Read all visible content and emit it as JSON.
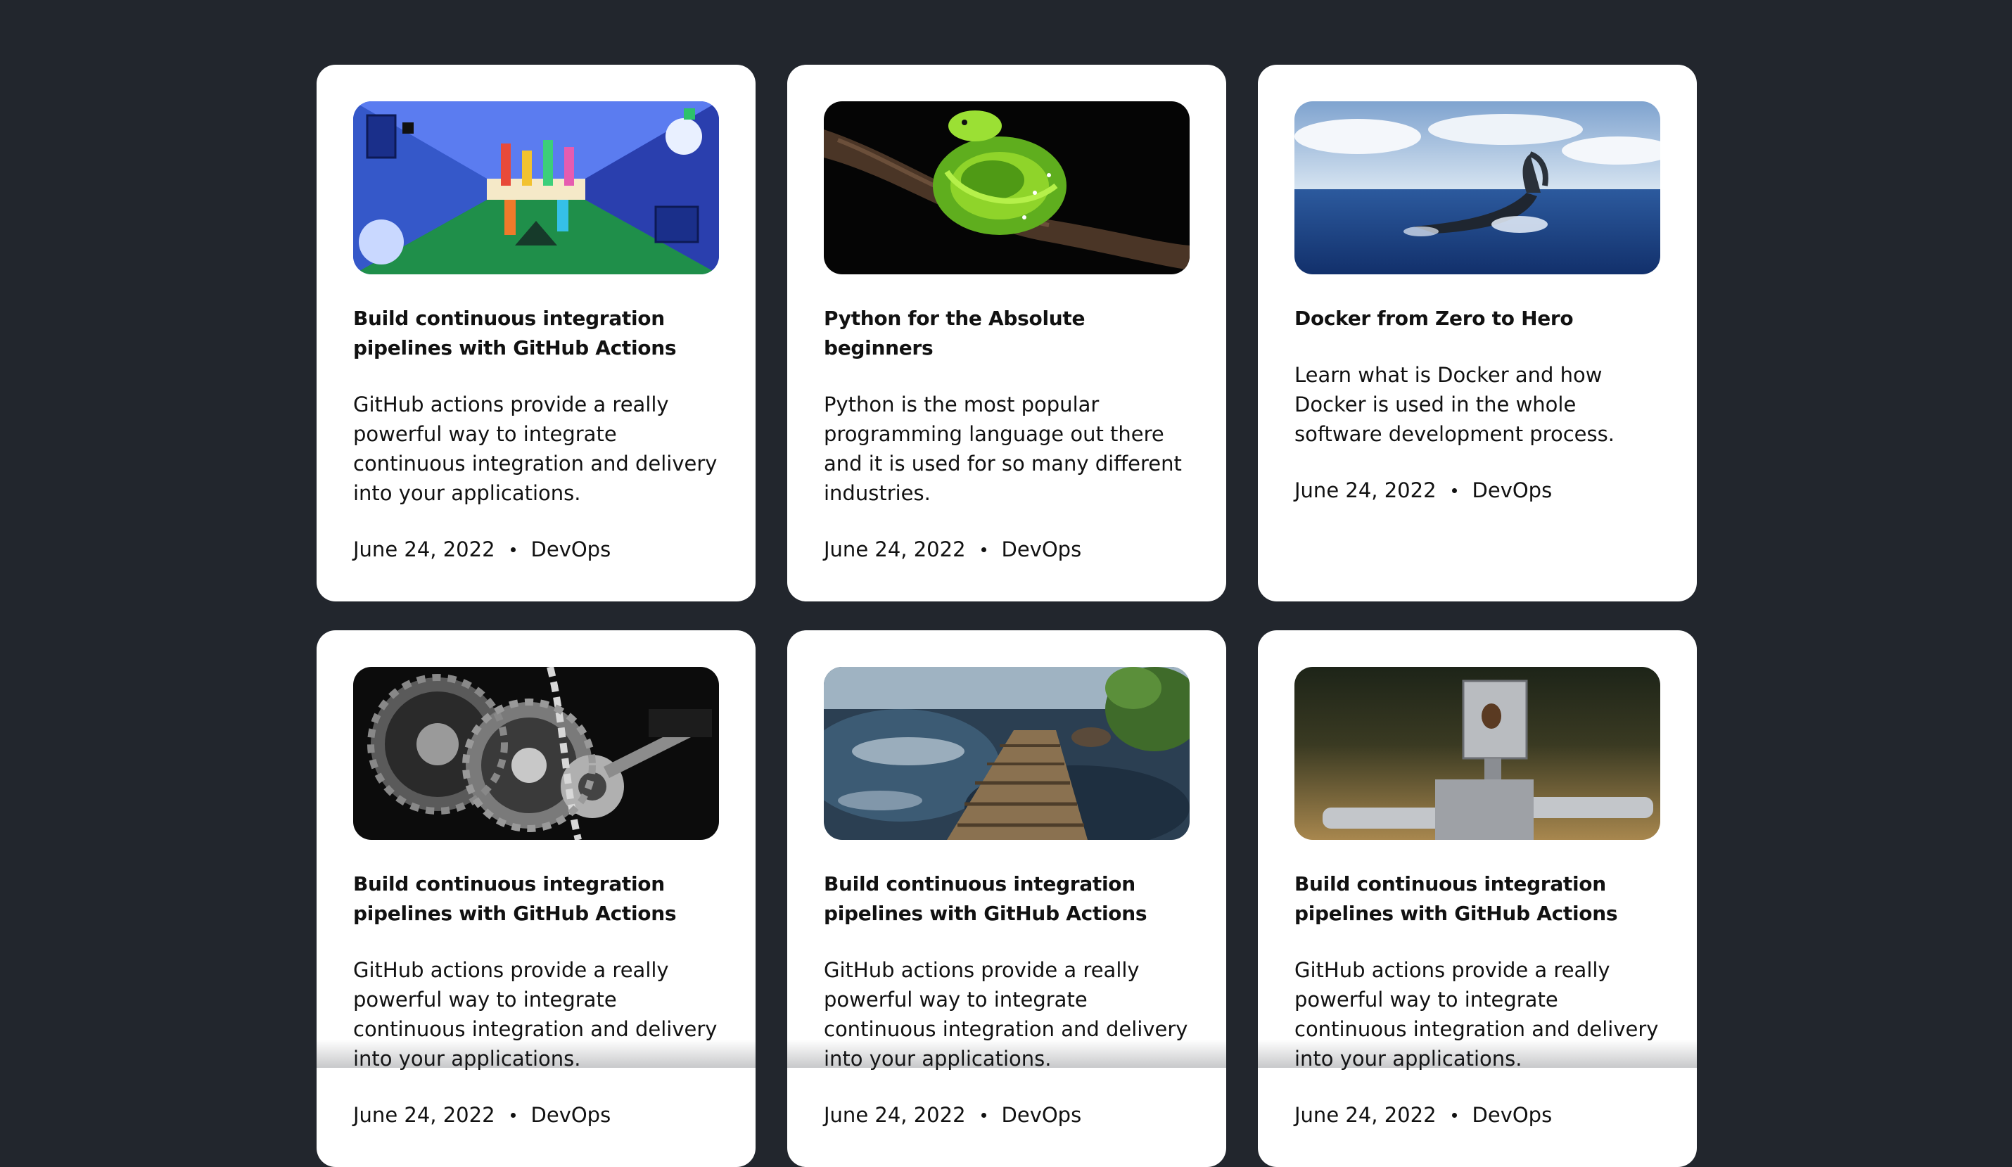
{
  "posts": [
    {
      "title": "Build continuous integration pipelines with GitHub Actions",
      "description": "GitHub actions provide a really powerful way to integrate continuous integration and delivery into your applications.",
      "date": "June 24, 2022",
      "category": "DevOps",
      "image": "colorful-abstract-corridor-illustration"
    },
    {
      "title": "Python for the Absolute beginners",
      "description": "Python is the most popular programming language out there and it is used for so many different industries.",
      "date": "June 24, 2022",
      "category": "DevOps",
      "image": "green-python-snake-on-branch"
    },
    {
      "title": "Docker from Zero to Hero",
      "description": "Learn what is Docker and how Docker is used in the whole software development process.",
      "date": "June 24, 2022",
      "category": "DevOps",
      "image": "whale-tail-in-ocean"
    },
    {
      "title": "Build continuous integration pipelines with GitHub Actions",
      "description": "GitHub actions provide a really powerful way to integrate continuous integration and delivery into your applications.",
      "date": "June 24, 2022",
      "category": "DevOps",
      "image": "black-and-white-gears"
    },
    {
      "title": "Build continuous integration pipelines with GitHub Actions",
      "description": "GitHub actions provide a really powerful way to integrate continuous integration and delivery into your applications.",
      "date": "June 24, 2022",
      "category": "DevOps",
      "image": "wooden-path-over-stream"
    },
    {
      "title": "Build continuous integration pipelines with GitHub Actions",
      "description": "GitHub actions provide a really powerful way to integrate continuous integration and delivery into your applications.",
      "date": "June 24, 2022",
      "category": "DevOps",
      "image": "metal-robot-in-field"
    }
  ]
}
